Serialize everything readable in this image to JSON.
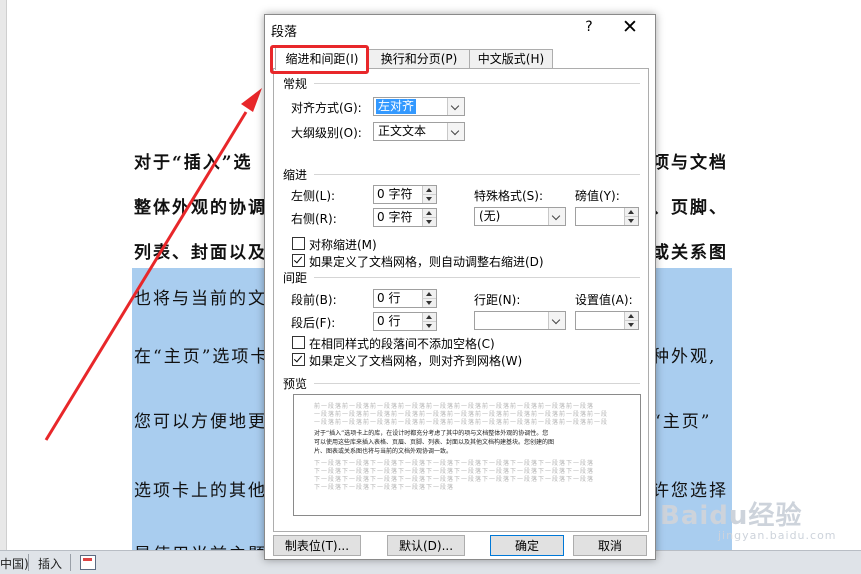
{
  "document": {
    "lines": [
      "对于“插入”选",
      "整体外观的协调",
      "列表、封面以及",
      "也将与当前的文",
      "在“主页”选项卡",
      "您可以方便地更",
      "选项卡上的其他",
      "是使用当前主题"
    ],
    "right_fragments": [
      "项与文档",
      "、页脚、",
      "或关系图",
      "种外观,",
      "“主页”",
      "许您选择"
    ]
  },
  "statusbar": {
    "language_fragment": "中国)",
    "insert_mode": "插入"
  },
  "watermark": {
    "main": "Baidu经验",
    "sub": "jingyan.baidu.com"
  },
  "dialog": {
    "title": "段落",
    "help": "?",
    "close": "✕",
    "tabs": [
      {
        "label": "缩进和间距(I)"
      },
      {
        "label": "换行和分页(P)"
      },
      {
        "label": "中文版式(H)"
      }
    ],
    "general": {
      "heading": "常规",
      "alignment_label": "对齐方式(G):",
      "alignment_value": "左对齐",
      "outline_label": "大纲级别(O):",
      "outline_value": "正文文本"
    },
    "indent": {
      "heading": "缩进",
      "left_label": "左侧(L):",
      "left_value": "0 字符",
      "right_label": "右侧(R):",
      "right_value": "0 字符",
      "special_label": "特殊格式(S):",
      "special_value": "(无)",
      "by_label": "磅值(Y):",
      "by_value": "",
      "mirror_label": "对称缩进(M)",
      "mirror_checked": false,
      "auto_adjust_label": "如果定义了文档网格，则自动调整右缩进(D)",
      "auto_adjust_checked": true
    },
    "spacing": {
      "heading": "间距",
      "before_label": "段前(B):",
      "before_value": "0 行",
      "after_label": "段后(F):",
      "after_value": "0 行",
      "line_label": "行距(N):",
      "line_value": "",
      "at_label": "设置值(A):",
      "at_value": "",
      "no_space_label": "在相同样式的段落间不添加空格(C)",
      "no_space_checked": false,
      "snap_grid_label": "如果定义了文档网格，则对齐到网格(W)",
      "snap_grid_checked": true
    },
    "preview": {
      "heading": "预览",
      "prev_lines": [
        "前一段落前一段落前一段落前一段落前一段落前一段落前一段落前一段落前一段落前一段落",
        "一段落前一段落前一段落前一段落前一段落前一段落前一段落前一段落前一段落前一段落前一段",
        "一段落前一段落前一段落前一段落前一段落前一段落前一段落前一段落前一段落前一段落前一段"
      ],
      "sample_lines": [
        "对于“插入”选项卡上的库，在设计时都充分考虑了其中的项与文档整体外观的协调性。您",
        "可以使用这些库来插入表格、页眉、页脚、列表、封面以及其他文档构建基块。您创建的图",
        "片、图表或关系图也将与当前的文档外观协调一致。"
      ],
      "next_lines": [
        "下一段落下一段落下一段落下一段落下一段落下一段落下一段落下一段落下一段落下一段落",
        "下一段落下一段落下一段落下一段落下一段落下一段落下一段落下一段落下一段落下一段落",
        "下一段落下一段落下一段落下一段落下一段落下一段落下一段落下一段落下一段落下一段落",
        "下一段落下一段落下一段落下一段落下一段落"
      ]
    },
    "buttons": {
      "tabs": "制表位(T)...",
      "default": "默认(D)...",
      "ok": "确定",
      "cancel": "取消"
    }
  },
  "colors": {
    "highlight": "#a9cdef",
    "annotation_red": "#e8272a",
    "selection": "#3399ff"
  }
}
